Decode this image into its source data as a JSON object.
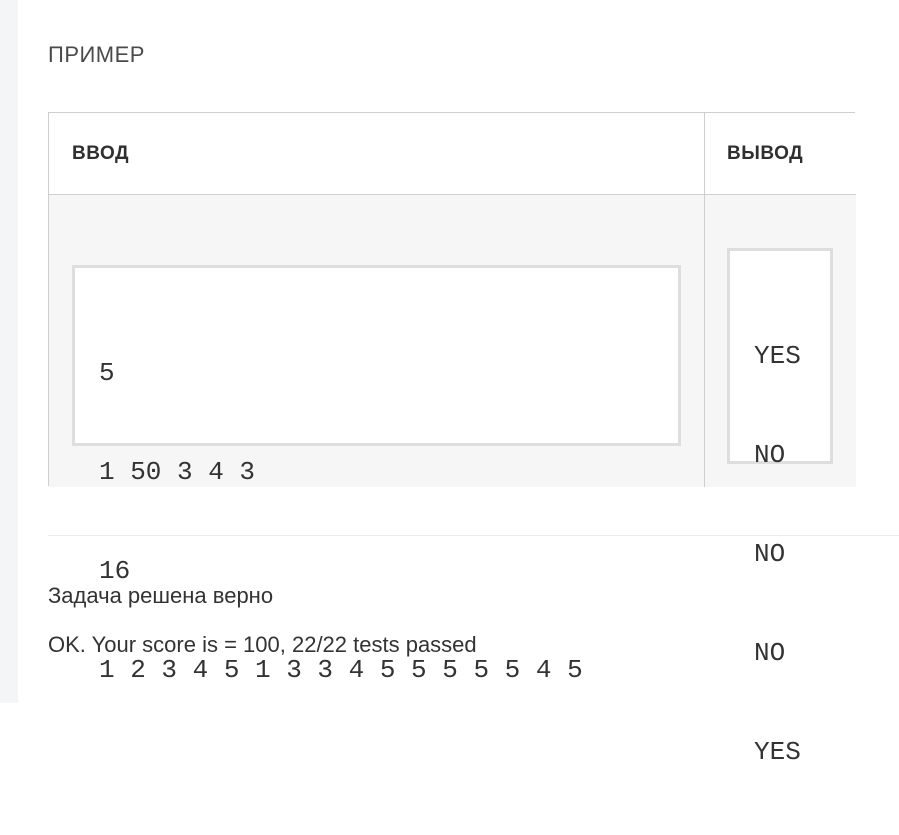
{
  "section": {
    "title": "ПРИМЕР"
  },
  "sample_table": {
    "input_header": "ВВОД",
    "output_header": "ВЫВОД",
    "input_lines": [
      "5",
      "1 50 3 4 3",
      "16",
      "1 2 3 4 5 1 3 3 4 5 5 5 5 5 4 5"
    ],
    "output_lines": [
      "YES",
      "NO",
      "NO",
      "NO",
      "YES"
    ]
  },
  "result": {
    "status": "Задача решена верно",
    "score": "OK. Your score is = 100, 22/22 tests passed"
  }
}
